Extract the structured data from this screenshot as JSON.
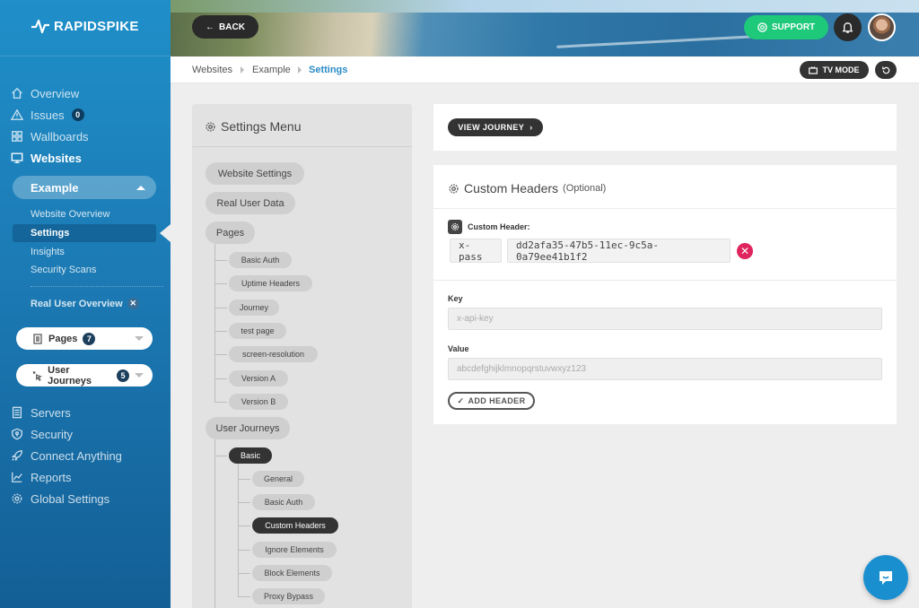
{
  "brand": {
    "name": "RAPIDSPIKE"
  },
  "nav": {
    "overview": "Overview",
    "issues": "Issues",
    "issues_count": "0",
    "wallboards": "Wallboards",
    "websites": "Websites",
    "site_name": "Example",
    "sub": {
      "website_overview": "Website Overview",
      "settings": "Settings",
      "insights": "Insights",
      "security_scans": "Security Scans",
      "real_user_overview": "Real User Overview"
    },
    "pages_label": "Pages",
    "pages_count": "7",
    "journeys_label": "User Journeys",
    "journeys_count": "5",
    "servers": "Servers",
    "security": "Security",
    "connect_anything": "Connect Anything",
    "reports": "Reports",
    "global_settings": "Global Settings"
  },
  "header": {
    "back": "BACK",
    "support": "SUPPORT",
    "tv_mode": "TV MODE"
  },
  "breadcrumb": [
    "Websites",
    "Example",
    "Settings"
  ],
  "settings_menu": {
    "title": "Settings Menu",
    "website_settings": "Website Settings",
    "real_user_data": "Real User Data",
    "pages": "Pages",
    "page_items": [
      "Basic Auth",
      "Uptime Headers",
      "Journey",
      "test page",
      "screen-resolution",
      "Version A",
      "Version B"
    ],
    "user_journeys": "User Journeys",
    "journey_name": "Basic",
    "journey_items": [
      "General",
      "Basic Auth",
      "Custom Headers",
      "Ignore Elements",
      "Block Elements",
      "Proxy Bypass"
    ]
  },
  "main": {
    "view_journey": "VIEW JOURNEY",
    "section_title": "Custom Headers",
    "section_optional": "(Optional)",
    "custom_header_label": "Custom Header:",
    "header_key": "x-pass",
    "header_value": "dd2afa35-47b5-11ec-9c5a-0a79ee41b1f2",
    "key_label": "Key",
    "key_placeholder": "x-api-key",
    "value_label": "Value",
    "value_placeholder": "abcdefghijklmnopqrstuvwxyz123",
    "add_header": "ADD HEADER"
  },
  "colors": {
    "accent": "#2a8bc7",
    "support": "#1ec97a",
    "danger": "#e0245e",
    "sidebar": "#1c7ab4"
  }
}
